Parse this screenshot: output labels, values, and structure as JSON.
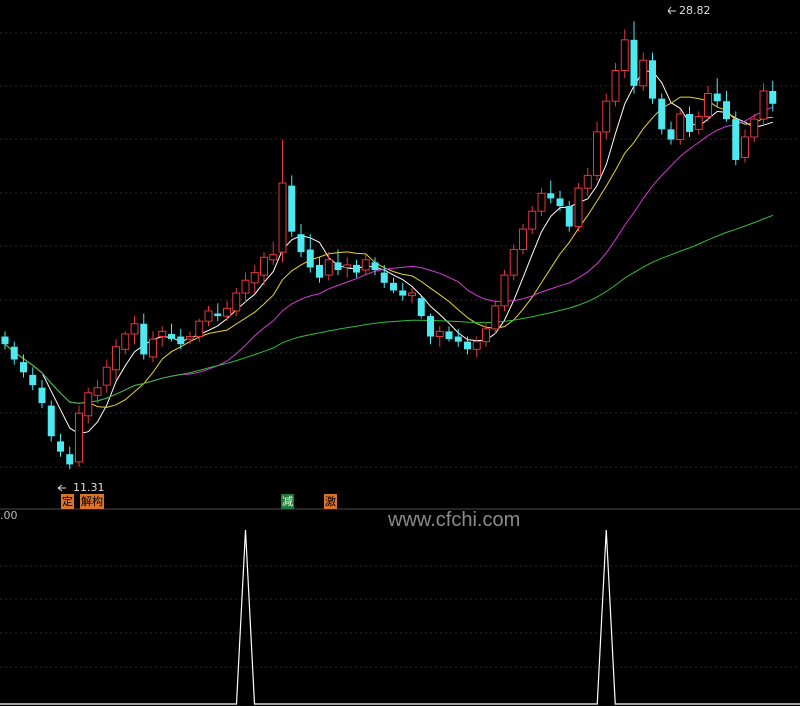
{
  "chart_data": [
    {
      "type": "candlestick",
      "xlabel": "",
      "ylabel": "",
      "ylim": [
        10.5,
        29.5
      ],
      "grid": true,
      "up_color": "#e0393e",
      "down_color": "#4ee8f0",
      "annotations": {
        "low_label": "11.31",
        "high_label": "28.82"
      },
      "candles": [
        [
          16.5,
          16.7,
          16.0,
          16.2
        ],
        [
          16.1,
          16.3,
          15.4,
          15.6
        ],
        [
          15.5,
          15.8,
          14.9,
          15.1
        ],
        [
          15.0,
          15.3,
          14.4,
          14.6
        ],
        [
          14.5,
          14.8,
          13.7,
          13.9
        ],
        [
          13.8,
          14.0,
          12.4,
          12.6
        ],
        [
          12.4,
          12.7,
          11.8,
          12.0
        ],
        [
          11.9,
          12.2,
          11.31,
          11.5
        ],
        [
          11.6,
          13.8,
          11.4,
          13.5
        ],
        [
          13.4,
          14.5,
          13.1,
          14.3
        ],
        [
          14.2,
          14.8,
          13.9,
          14.5
        ],
        [
          14.6,
          15.6,
          14.3,
          15.3
        ],
        [
          15.2,
          16.4,
          14.8,
          16.1
        ],
        [
          16.0,
          16.7,
          15.8,
          16.6
        ],
        [
          16.6,
          17.3,
          16.2,
          17.0
        ],
        [
          17.0,
          17.4,
          15.6,
          15.8
        ],
        [
          15.7,
          16.7,
          15.5,
          16.4
        ],
        [
          16.5,
          16.9,
          16.1,
          16.7
        ],
        [
          16.6,
          17.0,
          16.3,
          16.4
        ],
        [
          16.5,
          16.8,
          16.0,
          16.2
        ],
        [
          16.4,
          16.7,
          16.2,
          16.5
        ],
        [
          16.5,
          17.2,
          16.3,
          17.1
        ],
        [
          17.1,
          17.7,
          16.9,
          17.5
        ],
        [
          17.4,
          17.8,
          17.1,
          17.3
        ],
        [
          17.3,
          17.9,
          17.1,
          17.6
        ],
        [
          17.5,
          18.4,
          17.3,
          18.2
        ],
        [
          18.2,
          19.0,
          17.8,
          18.7
        ],
        [
          18.6,
          19.3,
          18.2,
          19.0
        ],
        [
          18.9,
          19.8,
          18.5,
          19.6
        ],
        [
          19.5,
          20.2,
          19.3,
          19.7
        ],
        [
          19.8,
          24.2,
          19.4,
          22.5
        ],
        [
          22.4,
          22.8,
          20.4,
          20.6
        ],
        [
          20.5,
          20.9,
          19.6,
          19.8
        ],
        [
          19.9,
          20.5,
          19.0,
          19.2
        ],
        [
          19.3,
          19.6,
          18.6,
          18.8
        ],
        [
          18.9,
          19.8,
          18.7,
          19.5
        ],
        [
          19.4,
          19.9,
          18.9,
          19.1
        ],
        [
          19.2,
          19.6,
          18.8,
          19.3
        ],
        [
          19.3,
          19.5,
          18.8,
          19.0
        ],
        [
          19.1,
          19.7,
          18.9,
          19.5
        ],
        [
          19.4,
          19.6,
          18.9,
          19.1
        ],
        [
          19.0,
          19.3,
          18.4,
          18.6
        ],
        [
          18.6,
          18.8,
          18.2,
          18.3
        ],
        [
          18.3,
          18.6,
          17.9,
          18.1
        ],
        [
          18.1,
          18.4,
          17.8,
          18.2
        ],
        [
          18.0,
          18.1,
          17.2,
          17.3
        ],
        [
          17.3,
          17.4,
          16.2,
          16.5
        ],
        [
          16.5,
          16.9,
          16.1,
          16.7
        ],
        [
          16.7,
          16.9,
          16.3,
          16.4
        ],
        [
          16.5,
          16.8,
          16.1,
          16.3
        ],
        [
          16.3,
          16.5,
          15.8,
          16.0
        ],
        [
          16.0,
          16.5,
          15.7,
          16.3
        ],
        [
          16.3,
          17.0,
          16.1,
          16.8
        ],
        [
          16.8,
          17.9,
          16.6,
          17.7
        ],
        [
          17.7,
          19.1,
          17.5,
          18.9
        ],
        [
          18.9,
          20.1,
          18.7,
          19.9
        ],
        [
          19.9,
          20.9,
          19.7,
          20.7
        ],
        [
          20.7,
          21.6,
          20.5,
          21.4
        ],
        [
          21.4,
          22.3,
          21.2,
          22.1
        ],
        [
          22.1,
          22.6,
          21.7,
          21.9
        ],
        [
          21.9,
          22.2,
          21.4,
          21.6
        ],
        [
          21.6,
          21.8,
          20.6,
          20.8
        ],
        [
          20.8,
          22.5,
          20.6,
          22.3
        ],
        [
          22.3,
          23.1,
          22.0,
          22.8
        ],
        [
          22.8,
          24.9,
          22.6,
          24.5
        ],
        [
          24.5,
          26.0,
          24.2,
          25.7
        ],
        [
          25.7,
          27.2,
          25.5,
          26.9
        ],
        [
          26.9,
          28.5,
          26.6,
          28.1
        ],
        [
          28.1,
          28.82,
          26.0,
          26.3
        ],
        [
          26.3,
          27.6,
          26.1,
          27.3
        ],
        [
          27.3,
          27.6,
          25.6,
          25.8
        ],
        [
          25.8,
          26.0,
          24.4,
          24.6
        ],
        [
          24.6,
          24.9,
          24.0,
          24.2
        ],
        [
          24.2,
          25.4,
          24.0,
          25.2
        ],
        [
          25.2,
          25.5,
          24.3,
          24.5
        ],
        [
          24.6,
          25.3,
          24.4,
          25.1
        ],
        [
          25.1,
          26.3,
          24.9,
          26.0
        ],
        [
          26.0,
          26.6,
          25.5,
          25.7
        ],
        [
          25.7,
          26.1,
          24.9,
          25.0
        ],
        [
          25.0,
          25.3,
          23.2,
          23.4
        ],
        [
          23.5,
          24.6,
          23.3,
          24.3
        ],
        [
          24.3,
          25.2,
          24.1,
          25.0
        ],
        [
          25.0,
          26.4,
          24.8,
          26.1
        ],
        [
          26.1,
          26.5,
          25.3,
          25.6
        ]
      ]
    },
    {
      "type": "line",
      "ylabel": "",
      "ylim": [
        0,
        1
      ],
      "y_top_label": ".00",
      "signal_indices": [
        26,
        65
      ]
    }
  ],
  "signals": {
    "tag1": "定",
    "tag2": "解构",
    "tag3": "减",
    "tag4": "激",
    "color_orange": "#d9742a",
    "color_green": "#1f7a3a"
  },
  "watermark": "www.cfchi.com"
}
